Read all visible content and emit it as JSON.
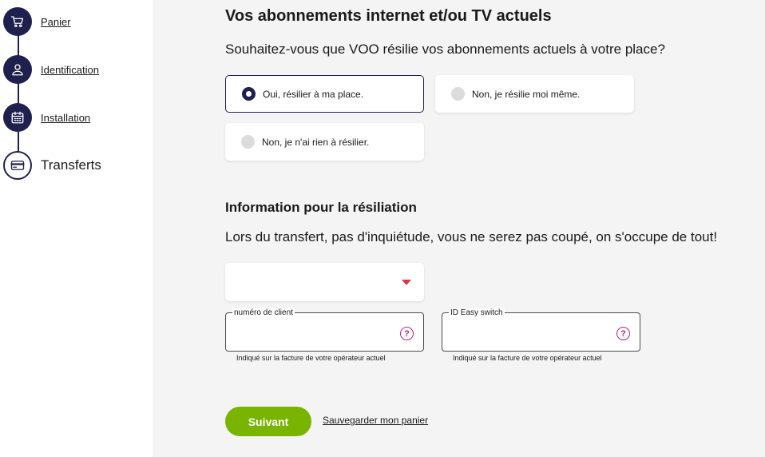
{
  "stepper": {
    "steps": [
      {
        "label": "Panier",
        "icon": "cart-icon",
        "state": "done"
      },
      {
        "label": "Identification",
        "icon": "user-icon",
        "state": "done"
      },
      {
        "label": "Installation",
        "icon": "calendar-icon",
        "state": "done"
      },
      {
        "label": "Transferts",
        "icon": "card-icon",
        "state": "current"
      }
    ]
  },
  "subscriptions": {
    "title": "Vos abonnements internet et/ou TV actuels",
    "question": "Souhaitez-vous que VOO résilie vos abonnements actuels à votre place?",
    "options": [
      {
        "label": "Oui, résilier à ma place.",
        "selected": true
      },
      {
        "label": "Non, je résilie moi même.",
        "selected": false
      },
      {
        "label": "Non, je n'ai rien à résilier.",
        "selected": false
      }
    ]
  },
  "termination": {
    "title": "Information pour la résiliation",
    "text": "Lors du transfert, pas d'inquiétude, vous ne serez pas coupé, on s'occupe de tout!",
    "operator_select": {
      "value": ""
    },
    "client_number": {
      "label": "numéro de client",
      "value": "",
      "hint": "Indiqué sur la facture de votre opérateur actuel"
    },
    "easy_switch": {
      "label": "ID Easy switch",
      "value": "",
      "hint": "Indiqué sur la facture de votre opérateur actuel"
    }
  },
  "actions": {
    "next_label": "Suivant",
    "save_label": "Sauvegarder mon panier"
  },
  "colors": {
    "navy": "#20204f",
    "accent_green": "#78b400",
    "help_magenta": "#b5277c",
    "arrow_red": "#d33a4a",
    "background": "#f4f4f4"
  }
}
